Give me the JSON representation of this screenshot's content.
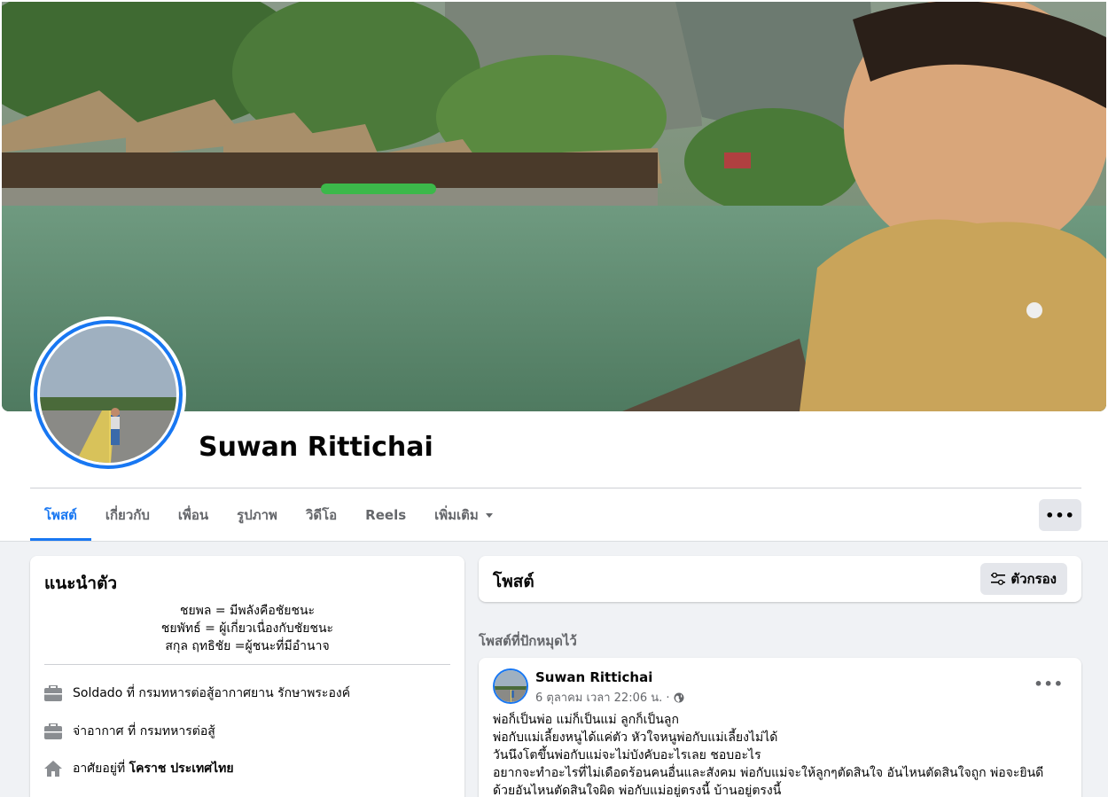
{
  "profile": {
    "name": "Suwan Rittichai"
  },
  "tabs": [
    {
      "label": "โพสต์",
      "active": true
    },
    {
      "label": "เกี่ยวกับ"
    },
    {
      "label": "เพื่อน"
    },
    {
      "label": "รูปภาพ"
    },
    {
      "label": "วิดีโอ"
    },
    {
      "label": "Reels"
    },
    {
      "label": "เพิ่มเติม"
    }
  ],
  "more_button": "•••",
  "intro": {
    "title": "แนะนำตัว",
    "bio_lines": [
      "ชยพล = มีพลังคือชัยชนะ",
      "ชยพัทธ์ = ผู้เกี่ยวเนื่องกับชัยชนะ",
      "สกุล ฤทธิชัย =ผู้ชนะที่มีอำนาจ"
    ],
    "work1": {
      "prefix": "Soldado ที่ ",
      "place": "กรมทหารต่อสู้อากาศยาน รักษาพระองค์",
      "icon": "briefcase-icon"
    },
    "work2": {
      "prefix": "จ่าอากาศ ที่ ",
      "place": "กรมทหารต่อสู้",
      "icon": "briefcase-icon"
    },
    "home": {
      "prefix": "อาศัยอยู่ที่ ",
      "place": "โคราช ประเทศไทย",
      "icon": "home-icon"
    }
  },
  "posts": {
    "title": "โพสต์",
    "filter_label": "ตัวกรอง",
    "pinned_label": "โพสต์ที่ปักหมุดไว้",
    "post": {
      "author": "Suwan Rittichai",
      "meta": "6 ตุลาคม เวลา 22:06 น. ·",
      "dots": "•••",
      "lines": [
        "พ่อก็เป็นพ่อ แม่ก็เป็นแม่ ลูกก็เป็นลูก",
        "พ่อกับแม่เลี้ยงหนูได้แค่ตัว หัวใจหนูพ่อกับแม่เลี้ยงไม่ได้",
        "วันนึงโตขึ้นพ่อกับแม่จะไม่บังคับอะไรเลย ชอบอะไร",
        "อยากจะทำอะไรที่ไม่เดือดร้อนคนอื่นและสังคม พ่อกับแม่จะให้ลูกๆตัดสินใจ อันไหนตัดสินใจถูก พ่อจะยินดี",
        "ด้วยอันไหนตัดสินใจผิด พ่อกับแม่อยู่ตรงนี้ บ้านอยู่ตรงนี้"
      ]
    }
  }
}
